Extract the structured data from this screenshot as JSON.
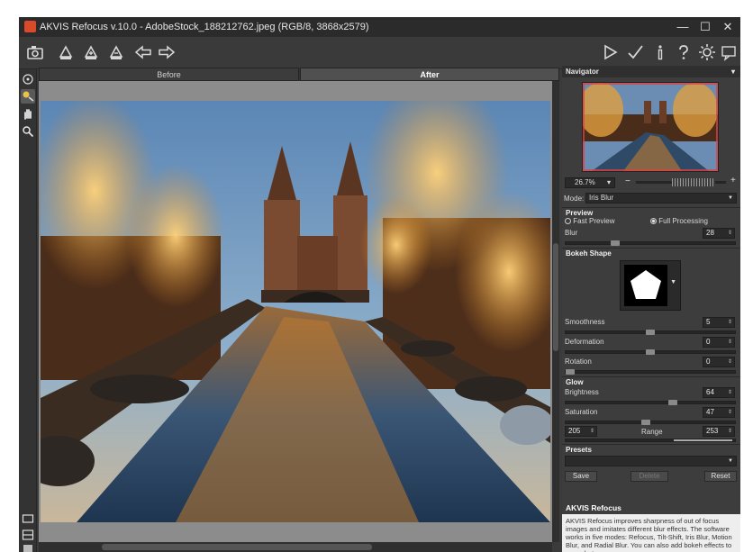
{
  "window": {
    "title": "AKVIS Refocus v.10.0 - AdobeStock_188212762.jpeg (RGB/8, 3868x2579)",
    "minimize": "—",
    "maximize": "☐",
    "close": "✕"
  },
  "toolbar": {
    "left_icons": [
      "camera-icon",
      "brush-icon",
      "brush-plus-icon",
      "brush-minus-icon",
      "undo-arrow-icon",
      "redo-arrow-icon"
    ],
    "right_icons": [
      "run-icon",
      "apply-icon",
      "info-icon",
      "help-icon",
      "settings-icon",
      "chat-icon"
    ]
  },
  "tools": [
    "move-icon",
    "selection-brush-icon",
    "hand-icon",
    "zoom-icon"
  ],
  "tabs": {
    "before": "Before",
    "after": "After"
  },
  "navigator": {
    "title": "Navigator",
    "zoom": "26.7%",
    "zoom_arrow": "▾",
    "zoom_out": "−",
    "zoom_in": "+"
  },
  "mode": {
    "label": "Mode:",
    "value": "Iris Blur"
  },
  "preview": {
    "title": "Preview",
    "fast": "Fast Preview",
    "full": "Full Processing",
    "selected": "Full Processing"
  },
  "blur": {
    "label": "Blur",
    "value": "28",
    "level": 0.28
  },
  "bokeh": {
    "title": "Bokeh Shape"
  },
  "smoothness": {
    "label": "Smoothness",
    "value": "5",
    "level": 0.5
  },
  "deformation": {
    "label": "Deformation",
    "value": "0",
    "level": 0.5
  },
  "rotation": {
    "label": "Rotation",
    "value": "0",
    "level": 0.0
  },
  "glow": {
    "title": "Glow",
    "brightness": {
      "label": "Brightness",
      "value": "64",
      "level": 0.64
    },
    "saturation": {
      "label": "Saturation",
      "value": "47",
      "level": 0.47
    },
    "range_label": "Range",
    "range_low": "205",
    "range_high": "253"
  },
  "presets": {
    "title": "Presets",
    "save": "Save",
    "delete": "Delete",
    "reset": "Reset"
  },
  "help": {
    "title": "AKVIS Refocus",
    "text": "AKVIS Refocus improves sharpness of out of focus images and imitates different blur effects. The software works in five modes: Refocus, Tilt-Shift, Iris Blur, Motion Blur, and Radial Blur. You can also add bokeh effects to your photos."
  },
  "colors": {
    "accent": "#3b3b3b",
    "panel": "#3d3d3d",
    "sky": "#6f93b8",
    "water": "#c87a28"
  }
}
